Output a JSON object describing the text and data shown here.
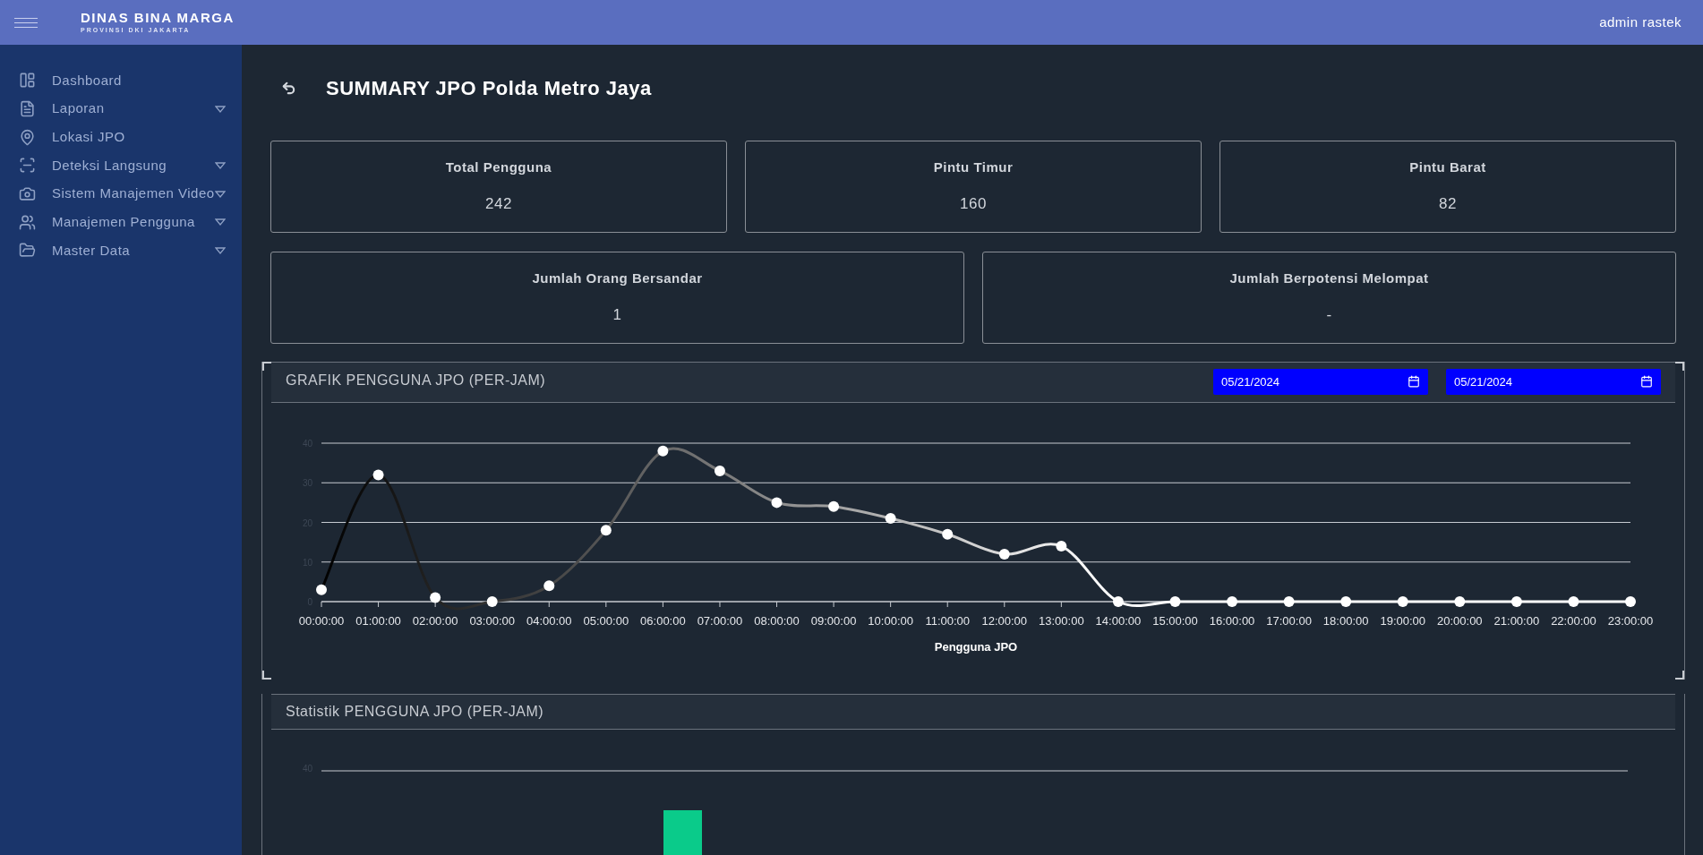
{
  "header": {
    "title": "DINAS BINA MARGA",
    "subtitle": "PROVINSI DKI JAKARTA",
    "user": "admin rastek"
  },
  "sidebar": {
    "items": [
      {
        "label": "Dashboard",
        "expandable": false
      },
      {
        "label": "Laporan",
        "expandable": true
      },
      {
        "label": "Lokasi JPO",
        "expandable": false
      },
      {
        "label": "Deteksi Langsung",
        "expandable": true
      },
      {
        "label": "Sistem Manajemen Video",
        "expandable": true
      },
      {
        "label": "Manajemen Pengguna",
        "expandable": true
      },
      {
        "label": "Master Data",
        "expandable": true
      }
    ]
  },
  "page_title": "SUMMARY JPO Polda Metro Jaya",
  "stat_cards": [
    {
      "label": "Total Pengguna",
      "value": "242"
    },
    {
      "label": "Pintu Timur",
      "value": "160"
    },
    {
      "label": "Pintu Barat",
      "value": "82"
    },
    {
      "label": "Jumlah Orang Bersandar",
      "value": "1"
    },
    {
      "label": "Jumlah Berpotensi Melompat",
      "value": "-"
    }
  ],
  "line_panel": {
    "title": "GRAFIK PENGGUNA JPO (PER-JAM)",
    "date_from": "05/21/2024",
    "date_to": "05/21/2024",
    "chart_data": {
      "type": "line",
      "grid": true,
      "categories": [
        "00:00:00",
        "01:00:00",
        "02:00:00",
        "03:00:00",
        "04:00:00",
        "05:00:00",
        "06:00:00",
        "07:00:00",
        "08:00:00",
        "09:00:00",
        "10:00:00",
        "11:00:00",
        "12:00:00",
        "13:00:00",
        "14:00:00",
        "15:00:00",
        "16:00:00",
        "17:00:00",
        "18:00:00",
        "19:00:00",
        "20:00:00",
        "21:00:00",
        "22:00:00",
        "23:00:00"
      ],
      "series": [
        {
          "name": "Pengguna JPO",
          "color": "#ffffff",
          "marker": true,
          "values": [
            3,
            32,
            1,
            0,
            4,
            18,
            38,
            33,
            25,
            24,
            21,
            17,
            12,
            14,
            0,
            0,
            0,
            0,
            0,
            0,
            0,
            0,
            0,
            0
          ]
        }
      ],
      "ylim": [
        0,
        40
      ],
      "yticks": [
        0,
        10,
        20,
        30,
        40
      ]
    }
  },
  "stats_panel": {
    "title": "Statistik PENGGUNA JPO (PER-JAM)",
    "ytick": "40"
  }
}
